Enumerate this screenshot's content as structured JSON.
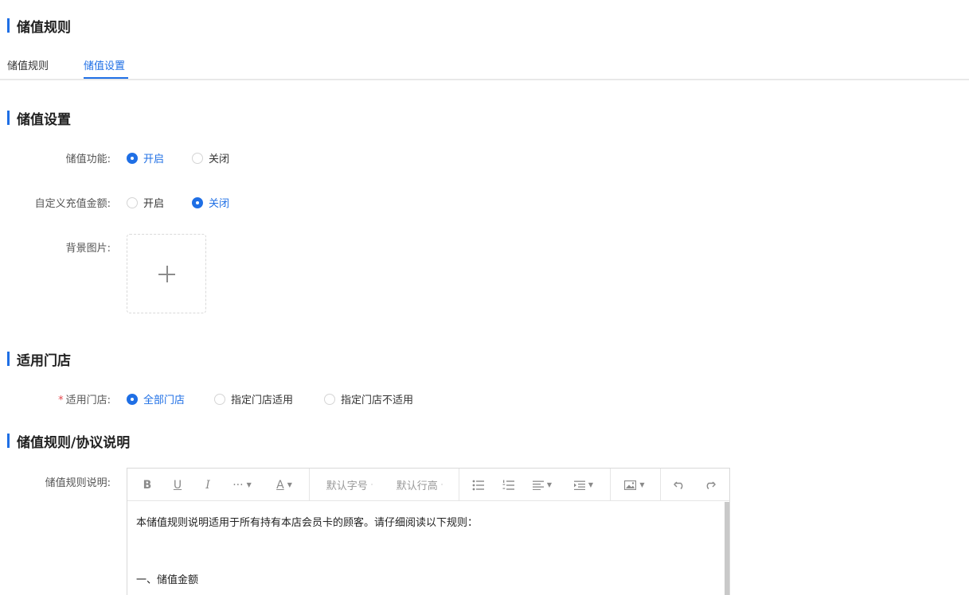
{
  "page": {
    "title": "储值规则"
  },
  "tabs": [
    {
      "label": "储值规则",
      "active": false
    },
    {
      "label": "储值设置",
      "active": true
    }
  ],
  "sections": {
    "store_value_settings": "储值设置",
    "applicable_stores": "适用门店",
    "rules_agreement": "储值规则/协议说明"
  },
  "form": {
    "store_value_function": {
      "label": "储值功能:",
      "options": [
        "开启",
        "关闭"
      ],
      "selected": "开启"
    },
    "custom_recharge_amount": {
      "label": "自定义充值金额:",
      "options": [
        "开启",
        "关闭"
      ],
      "selected": "关闭"
    },
    "background_image": {
      "label": "背景图片:"
    },
    "applicable_store": {
      "required_mark": "*",
      "label": "适用门店:",
      "options": [
        "全部门店",
        "指定门店适用",
        "指定门店不适用"
      ],
      "selected": "全部门店"
    },
    "rules_description": {
      "label": "储值规则说明:"
    }
  },
  "editor": {
    "toolbar": {
      "bold": "B",
      "underline": "U",
      "italic": "I",
      "more": "···",
      "font_color": "A",
      "font_size_placeholder": "默认字号",
      "line_height_placeholder": "默认行高"
    },
    "content": {
      "line1": "本储值规则说明适用于所有持有本店会员卡的顾客。请仔细阅读以下规则：",
      "line2": "一、储值金额"
    }
  },
  "colors": {
    "accent": "#1f6fe5",
    "required": "#e5484d",
    "border": "#d9d9d9"
  }
}
